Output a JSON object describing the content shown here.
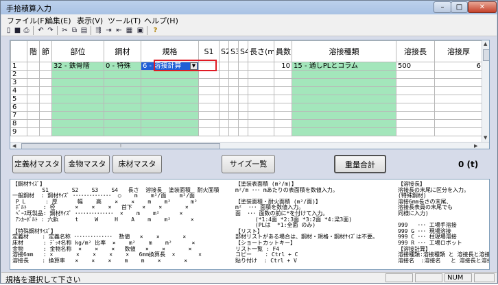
{
  "window": {
    "title": "手拾積算入力",
    "min": "–",
    "max": "□",
    "close": "✕"
  },
  "menu": [
    "ファイル(F)",
    "編集(E)",
    "表示(V)",
    "ツール(T)",
    "ヘルプ(H)"
  ],
  "toolbar": [
    {
      "icon": "new-file-icon",
      "glyph": "▯"
    },
    {
      "icon": "save-icon",
      "glyph": "■"
    },
    {
      "icon": "print-icon",
      "glyph": "⎙"
    },
    {
      "icon": "undo-icon",
      "glyph": "↶"
    },
    {
      "icon": "redo-icon",
      "glyph": "↷"
    },
    {
      "icon": "cut-icon",
      "glyph": "✂"
    },
    {
      "icon": "copy-icon",
      "glyph": "⧉"
    },
    {
      "icon": "paste-icon",
      "glyph": "▤"
    },
    {
      "icon": "insert-row-icon",
      "glyph": "⇶"
    },
    {
      "icon": "append-row-icon",
      "glyph": "⇥"
    },
    {
      "icon": "delete-row-icon",
      "glyph": "⇤"
    },
    {
      "icon": "table-icon",
      "glyph": "▦"
    },
    {
      "icon": "calculator-icon",
      "glyph": "▣"
    },
    {
      "icon": "help-icon",
      "glyph": "?"
    }
  ],
  "grid": {
    "headers": [
      "",
      "階",
      "節",
      "部位",
      "鋼材",
      "規格",
      "S1",
      "S2",
      "S3",
      "S4",
      "長さ(mm",
      "員数",
      "溶接種類",
      "溶接長",
      "溶接厚"
    ],
    "row1": {
      "no": "1",
      "kai": "",
      "setsu": "",
      "bui": "32 - 鉄骨階",
      "kozai": "0 - 特殊",
      "kikaku": "6 - 溶接計算",
      "s1": "",
      "s2": "",
      "s3": "",
      "s4": "",
      "length": "",
      "count": "10",
      "weld_type": "15 - 通しPLとコラム",
      "weld_len": "500",
      "weld_thk": "6"
    },
    "row_numbers": [
      "2",
      "3",
      "4",
      "5",
      "6",
      "7",
      "8",
      "9"
    ]
  },
  "buttons": {
    "def_master": "定義材マスタ",
    "hardware_master": "金物マスタ",
    "floor_master": "床材マスタ",
    "size_list": "サイズ一覧",
    "weight_total": "重量合計"
  },
  "total": "0 (t)",
  "help": {
    "col1": "【鋼材ｻｲｽﾞ】\n         S1       S2    S3    S4   長さ  溶接長  塗装面積  耐火面積\n一般鋼材  : 鋼材ｻｲｽﾞ ･･････････････  ○    m    m²/面    m²/面\n P L      : 厚      幅    高    ×    ×    m    m²      m²\n ﾎﾞﾙﾄ     : 径      ×    ×    ×   首下   ×    ×       ×\n ﾍﾞｰｽ既製品: 鋼材ｻｲｽﾞ ･･････････････  ×    m    m²      ×\n ｱﾝｶｰﾎﾞﾙﾄ : 六鋲     t     W     H    A    m    m²      ×\n\n【特殊鋼材ｻｲｽﾞ】\n定義材    : 定義名称 ･･････････････  数値   ×    ×       ×\n床材      : ﾃﾞｯｷ名称 kg/m² 比率  ×    m²    m    m²      ×\n金物      : 金物名称  ×    ×    ×   数値   ×    ×       ×\n溶接6mm   : ×       ×    ×    ×    ×   6mm換算長  ×       ×\n溶接長    : 換算率   ×    ×    ×    m    m    ×       ×",
    "col2": "【塗装表面積 (m²/m)】\nm²/m ･･･ mあたりの表面積を数値入力。\n\n【塗装面積・耐火面積 (m²/面)】\nm²  ･･･ 面積を数値入力。\n面  ･･･ 面数の前に*を付けて入力。\n      (*1:4面 *2:3面 *3:2面 *4:梁3面)\n      (PLは  *1:全面 のみ)\n【リスト】\n部材リストがある場合は、鋼材・規格・鋼材ｻｲｽﾞは不要。\n【ショートカットキー】\nリスト一覧 : F4\nコピー    : Ctrl + C\n貼り付け  : Ctrl + V",
    "col3": "【溶接長】\n溶接長の末尾に区分を入力。\n(特殊鋼材)\n溶接6mm長さの末尾、\n溶接長表員の末尾でも\n同様に入力)\n\n999   ･･･ 工場手溶接\n999 G ･･･ 現場溶接\n999 C ･･･ 柱現場溶接\n999 R ･･･ 工場ロボット\n【溶接計算】\n溶接種類:溶接種類 と 溶接長と溶接圧力\n溶接名  :溶接名   と 溶接長と溶接圧力"
  },
  "status": {
    "message": "規格を選択して下さい",
    "num": "NUM"
  }
}
